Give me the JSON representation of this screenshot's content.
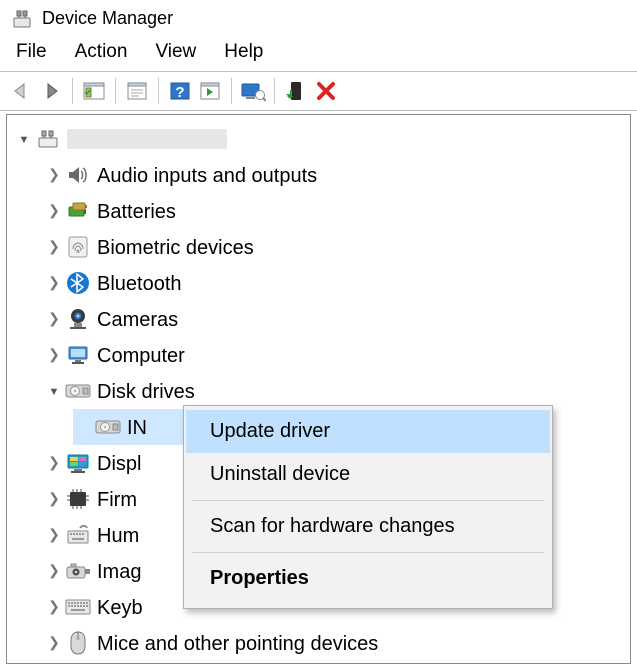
{
  "window": {
    "title": "Device Manager"
  },
  "menubar": {
    "items": [
      "File",
      "Action",
      "View",
      "Help"
    ]
  },
  "toolbar_icons": [
    "back",
    "forward",
    "show-hide-console",
    "properties",
    "help",
    "update",
    "scan",
    "uninstall-red-x"
  ],
  "tree": {
    "root": {
      "name_hidden": true
    },
    "items": [
      {
        "label": "Audio inputs and outputs",
        "icon": "speaker"
      },
      {
        "label": "Batteries",
        "icon": "battery"
      },
      {
        "label": "Biometric devices",
        "icon": "fingerprint"
      },
      {
        "label": "Bluetooth",
        "icon": "bluetooth"
      },
      {
        "label": "Cameras",
        "icon": "camera"
      },
      {
        "label": "Computer",
        "icon": "computer"
      },
      {
        "label": "Disk drives",
        "icon": "disk",
        "expanded": true,
        "children": [
          {
            "label": "IN",
            "icon": "disk",
            "selected": true,
            "truncated": true
          }
        ]
      },
      {
        "label": "Displ",
        "icon": "display",
        "truncated": true
      },
      {
        "label": "Firm",
        "icon": "firmware",
        "truncated": true
      },
      {
        "label": "Hum",
        "icon": "hid",
        "truncated": true
      },
      {
        "label": "Imag",
        "icon": "imaging",
        "truncated": true
      },
      {
        "label": "Keyb",
        "icon": "keyboard",
        "truncated": true
      },
      {
        "label": "Mice and other pointing devices",
        "icon": "mouse"
      }
    ]
  },
  "context_menu": {
    "items": [
      {
        "label": "Update driver",
        "hover": true
      },
      {
        "label": "Uninstall device"
      },
      {
        "sep": true
      },
      {
        "label": "Scan for hardware changes"
      },
      {
        "sep": true
      },
      {
        "label": "Properties",
        "bold": true
      }
    ]
  }
}
